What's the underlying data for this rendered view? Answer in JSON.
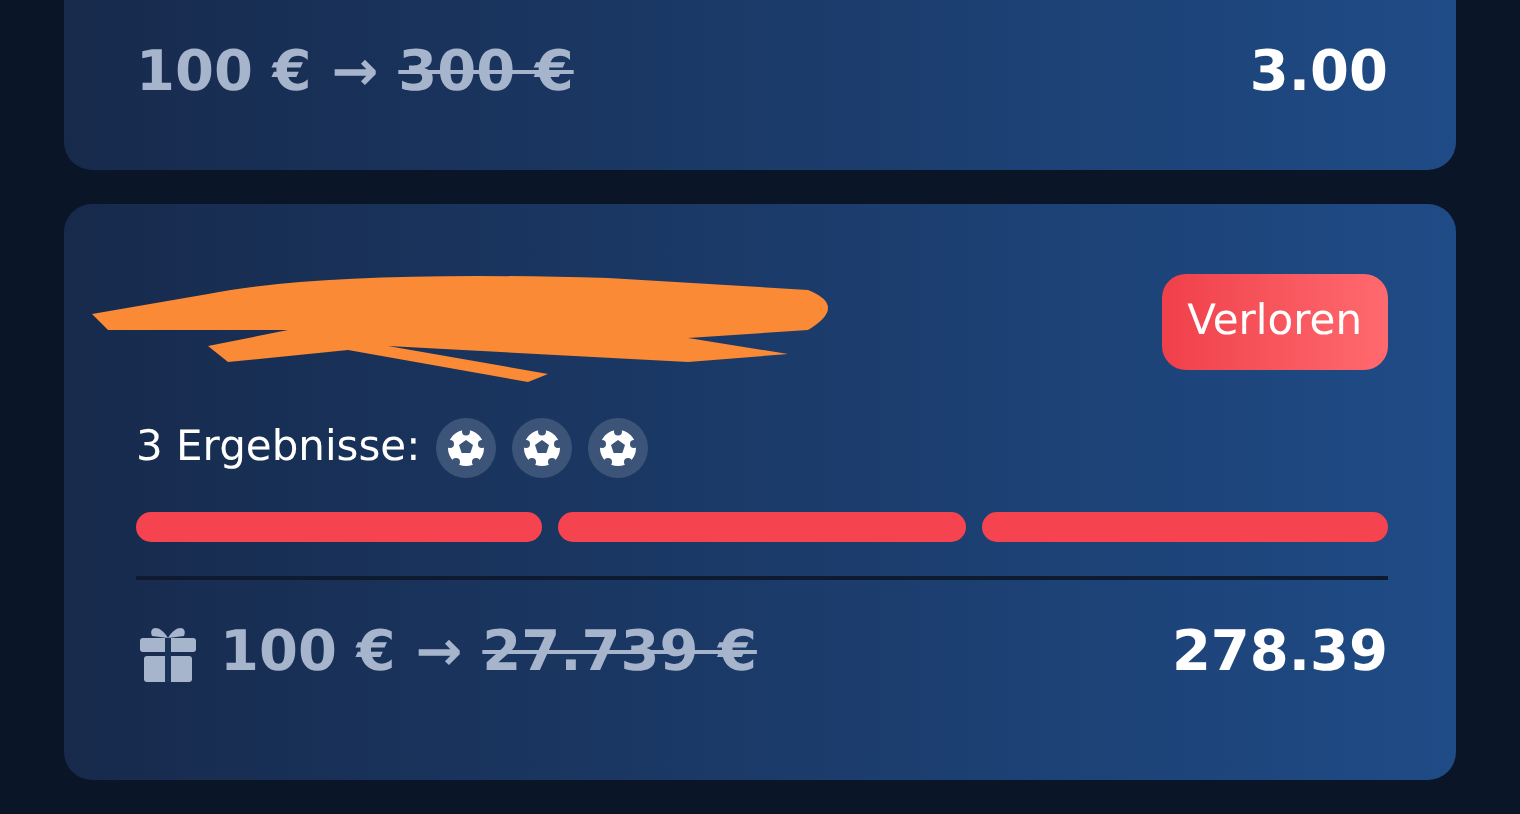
{
  "bets": [
    {
      "stake": "100 €",
      "arrow": "→",
      "payout": "300 €",
      "payout_struck": true,
      "odds": "3.00",
      "cut_top": true
    },
    {
      "status": "Verloren",
      "redacted_title": true,
      "results_label": "3 Ergebnisse:",
      "results": [
        {
          "kind": "football"
        },
        {
          "kind": "football"
        },
        {
          "kind": "football"
        }
      ],
      "legs": [
        {
          "color": "#f5444f"
        },
        {
          "color": "#f5444f"
        },
        {
          "color": "#f5444f"
        }
      ],
      "bonus": true,
      "stake": "100 €",
      "arrow": "→",
      "payout": "27.739 €",
      "payout_struck": true,
      "odds": "278.39",
      "cut_top": false
    }
  ]
}
